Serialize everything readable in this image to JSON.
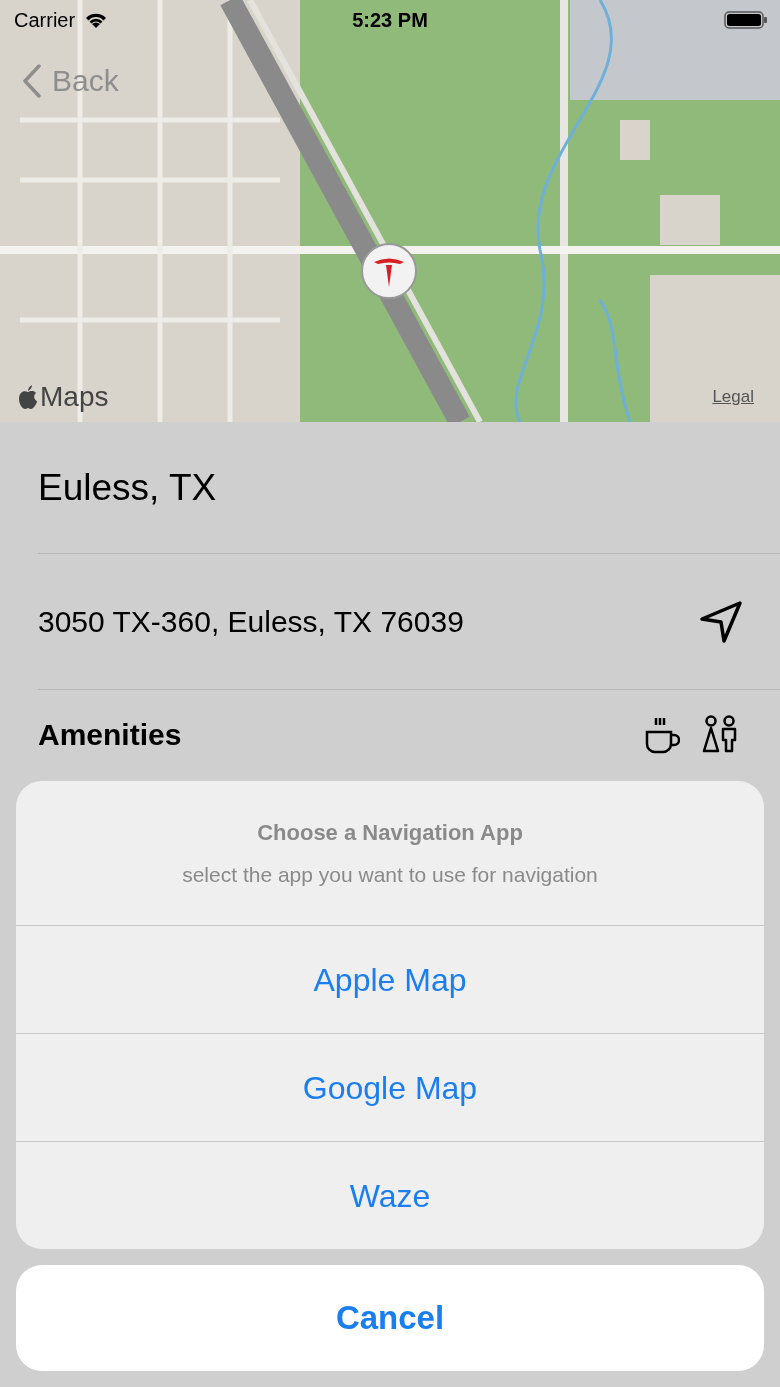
{
  "status_bar": {
    "carrier": "Carrier",
    "time": "5:23 PM"
  },
  "nav": {
    "back_label": "Back"
  },
  "map": {
    "attribution": "Maps",
    "legal": "Legal"
  },
  "location": {
    "title": "Euless, TX",
    "address": "3050 TX-360, Euless, TX 76039"
  },
  "amenities": {
    "label": "Amenities"
  },
  "action_sheet": {
    "title": "Choose a Navigation App",
    "message": "select the app you want to use for navigation",
    "options": [
      "Apple Map",
      "Google Map",
      "Waze"
    ],
    "cancel": "Cancel"
  }
}
